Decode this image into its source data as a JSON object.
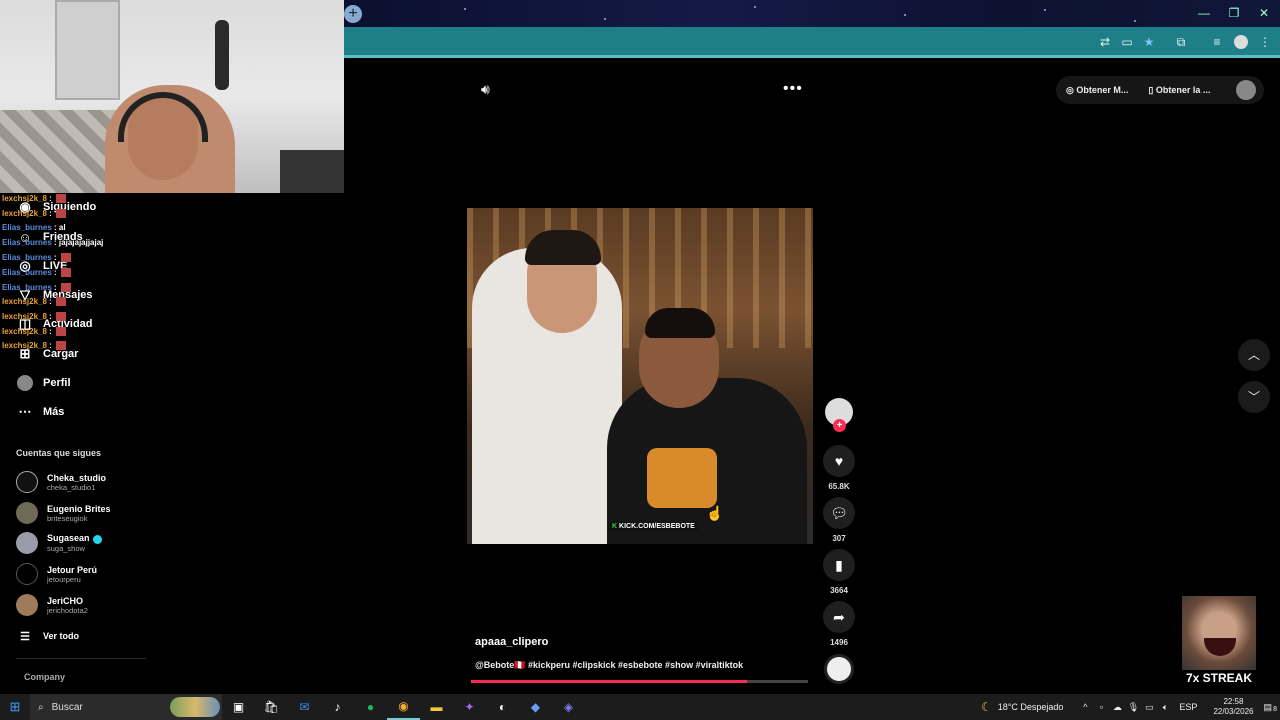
{
  "browser": {
    "new_tab_icon": "plus-icon",
    "window_buttons": [
      "—",
      "❐",
      "✕"
    ],
    "toolbar_icons": [
      "translate-icon",
      "cast-icon",
      "star-icon",
      "extensions-icon",
      "media-icon",
      "profile-icon",
      "menu-icon"
    ],
    "accent": "#1f7f86"
  },
  "sidebar": {
    "nav": [
      {
        "label": "Siguiendo",
        "icon": "following-icon"
      },
      {
        "label": "Friends",
        "icon": "friends-icon"
      },
      {
        "label": "LIVE",
        "icon": "live-icon"
      },
      {
        "label": "Mensajes",
        "icon": "messages-icon"
      },
      {
        "label": "Actividad",
        "icon": "activity-icon"
      },
      {
        "label": "Cargar",
        "icon": "upload-icon"
      },
      {
        "label": "Perfil",
        "icon": "profile-icon"
      },
      {
        "label": "Más",
        "icon": "more-icon"
      }
    ],
    "following_header": "Cuentas que sigues",
    "accounts": [
      {
        "name": "Cheka_studio",
        "handle": "cheka_studio1"
      },
      {
        "name": "Eugenio Brites",
        "handle": "briteseugiok"
      },
      {
        "name": "Sugasean",
        "handle": "suga_show",
        "verified": true
      },
      {
        "name": "Jetour Perú",
        "handle": "jetourperu"
      },
      {
        "name": "JeriCHO",
        "handle": "jerichodota2"
      }
    ],
    "see_all": "Ver todo",
    "company": "Company"
  },
  "chat": [
    {
      "user": "lexchsj2k_8",
      "msg": "",
      "color": "orange"
    },
    {
      "user": "lexchsj2k_8",
      "msg": "",
      "color": "orange"
    },
    {
      "user": "Elias_burnes",
      "msg": "al",
      "color": "blue"
    },
    {
      "user": "Elias_burnes",
      "msg": "jajajajajjajaj",
      "color": "blue"
    },
    {
      "user": "Elias_burnes",
      "msg": "",
      "color": "blue"
    },
    {
      "user": "Elias_burnes",
      "msg": "",
      "color": "blue"
    },
    {
      "user": "Elias_burnes",
      "msg": "",
      "color": "blue"
    },
    {
      "user": "lexchsj2k_8",
      "msg": "",
      "color": "orange"
    },
    {
      "user": "lexchsj2k_8",
      "msg": "",
      "color": "orange"
    },
    {
      "user": "lexchsj2k_8",
      "msg": "",
      "color": "orange"
    },
    {
      "user": "lexchsj2k_8",
      "msg": "",
      "color": "orange"
    }
  ],
  "top": {
    "btn1": "Obtener M...",
    "btn2": "Obtener la ..."
  },
  "video": {
    "watermark": "KICK.COM/ESBEBOTE",
    "author": "apaaa_clipero",
    "caption": "@Bebote🇵🇪 #kickperu #clipskick #esbebote #show #viraltiktok",
    "progress": 0.82
  },
  "actions": {
    "likes": "65.8K",
    "comments": "307",
    "saves": "3664",
    "shares": "1496"
  },
  "overlay": {
    "streak": "7x STREAK"
  },
  "taskbar": {
    "search": "Buscar",
    "weather": "18°C  Despejado",
    "lang": "ESP",
    "time": "22:58",
    "date": "22/03/2026",
    "notifications": "8"
  }
}
